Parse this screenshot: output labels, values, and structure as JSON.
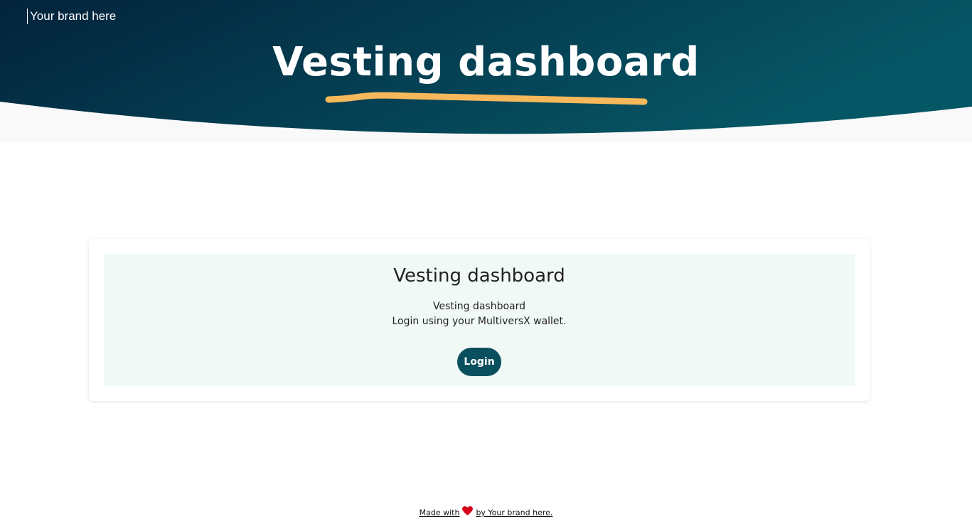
{
  "header": {
    "brand": "Your brand here",
    "title": "Vesting dashboard",
    "gradient_start": "#03233c",
    "gradient_end": "#065766",
    "underline_color": "#f6b85a"
  },
  "card": {
    "title": "Vesting dashboard",
    "subtitle_line1": "Vesting dashboard",
    "subtitle_line2": "Login using your MultiversX wallet.",
    "login_label": "Login",
    "button_color": "#0a4f5e",
    "panel_color": "#f1f9f6"
  },
  "footer": {
    "made_with": "Made with",
    "heart_icon": "heart-icon",
    "heart_color": "#d6001c",
    "by_text": "by Your brand here."
  }
}
